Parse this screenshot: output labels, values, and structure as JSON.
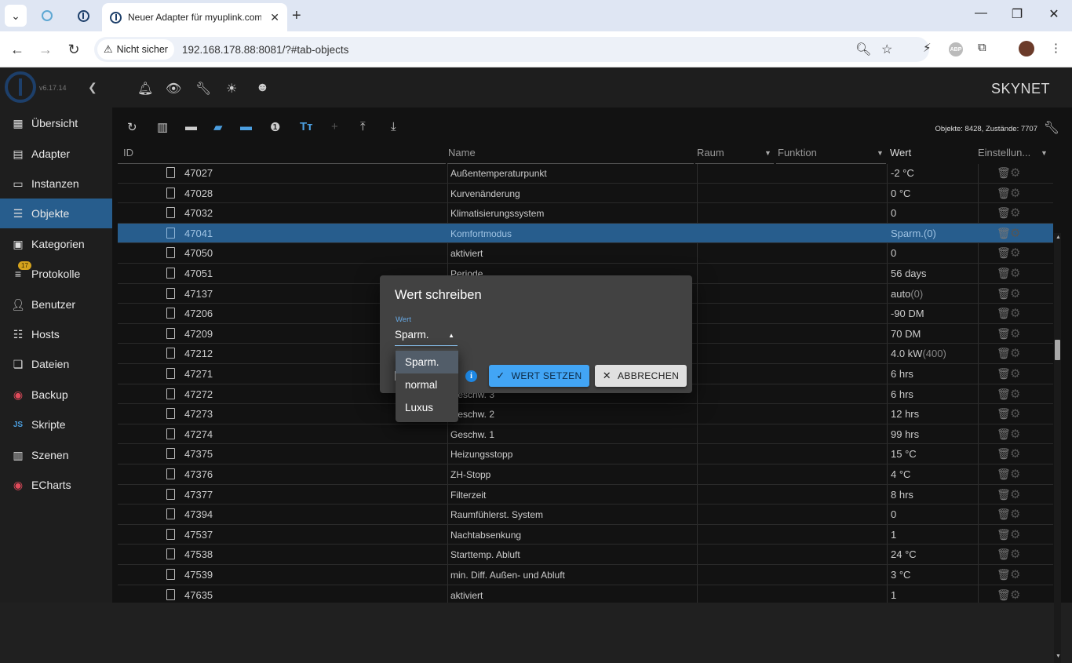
{
  "browser": {
    "tab_title": "Neuer Adapter für myuplink.com",
    "security_label": "Nicht sicher",
    "url": "192.168.178.88:8081/?#tab-objects"
  },
  "app": {
    "version": "v6.17.14",
    "host_name": "SKYNET",
    "object_count_text": "Objekte: 8428, Zustände: 7707",
    "accent_color": "#275d8d"
  },
  "sidebar": {
    "items": [
      {
        "label": "Übersicht",
        "icon": "grid-icon"
      },
      {
        "label": "Adapter",
        "icon": "store-icon"
      },
      {
        "label": "Instanzen",
        "icon": "instances-icon"
      },
      {
        "label": "Objekte",
        "icon": "list-icon"
      },
      {
        "label": "Kategorien",
        "icon": "categories-icon"
      },
      {
        "label": "Protokolle",
        "icon": "logs-icon"
      },
      {
        "label": "Benutzer",
        "icon": "user-icon"
      },
      {
        "label": "Hosts",
        "icon": "hosts-icon"
      },
      {
        "label": "Dateien",
        "icon": "files-icon"
      },
      {
        "label": "Backup",
        "icon": "backup-icon"
      },
      {
        "label": "Skripte",
        "icon": "js-icon"
      },
      {
        "label": "Szenen",
        "icon": "scenes-icon"
      },
      {
        "label": "ECharts",
        "icon": "echarts-icon"
      }
    ],
    "log_badge": "17"
  },
  "columns": {
    "id": "ID",
    "name": "Name",
    "room": "Raum",
    "function": "Funktion",
    "value": "Wert",
    "settings": "Einstellun..."
  },
  "rows": [
    {
      "id": "47027",
      "name": "Außentemperaturpunkt",
      "value": "-2 °C",
      "sub": ""
    },
    {
      "id": "47028",
      "name": "Kurvenänderung",
      "value": "0 °C",
      "sub": ""
    },
    {
      "id": "47032",
      "name": "Klimatisierungssystem",
      "value": "0",
      "sub": ""
    },
    {
      "id": "47041",
      "name": "Komfortmodus",
      "value": "Sparm.",
      "sub": "(0)"
    },
    {
      "id": "47050",
      "name": "aktiviert",
      "value": "0",
      "sub": ""
    },
    {
      "id": "47051",
      "name": "Periode",
      "value": "56 days",
      "sub": ""
    },
    {
      "id": "47137",
      "name": "",
      "value": "auto",
      "sub": "(0)"
    },
    {
      "id": "47206",
      "name": "",
      "value": "-90 DM",
      "sub": ""
    },
    {
      "id": "47209",
      "name": "",
      "value": "70 DM",
      "sub": ""
    },
    {
      "id": "47212",
      "name": "",
      "value": "4.0 kW",
      "sub": "(400)"
    },
    {
      "id": "47271",
      "name": "",
      "value": "6 hrs",
      "sub": ""
    },
    {
      "id": "47272",
      "name": "Geschw. 3",
      "value": "6 hrs",
      "sub": ""
    },
    {
      "id": "47273",
      "name": "Geschw. 2",
      "value": "12 hrs",
      "sub": ""
    },
    {
      "id": "47274",
      "name": "Geschw. 1",
      "value": "99 hrs",
      "sub": ""
    },
    {
      "id": "47375",
      "name": "Heizungsstopp",
      "value": "15 °C",
      "sub": ""
    },
    {
      "id": "47376",
      "name": "ZH-Stopp",
      "value": "4 °C",
      "sub": ""
    },
    {
      "id": "47377",
      "name": "Filterzeit",
      "value": "8 hrs",
      "sub": ""
    },
    {
      "id": "47394",
      "name": "Raumfühlerst. System",
      "value": "0",
      "sub": ""
    },
    {
      "id": "47537",
      "name": "Nachtabsenkung",
      "value": "1",
      "sub": ""
    },
    {
      "id": "47538",
      "name": "Starttemp. Abluft",
      "value": "24 °C",
      "sub": ""
    },
    {
      "id": "47539",
      "name": "min. Diff. Außen- und Abluft",
      "value": "3 °C",
      "sub": ""
    },
    {
      "id": "47635",
      "name": "aktiviert",
      "value": "1",
      "sub": ""
    }
  ],
  "selected_row_id": "47041",
  "dialog": {
    "title": "Wert schreiben",
    "field_label": "Wert",
    "selected_value": "Sparm.",
    "options": [
      "Sparm.",
      "normal",
      "Luxus"
    ],
    "set_button": "WERT SETZEN",
    "cancel_button": "ABBRECHEN",
    "info_glyph": "i"
  }
}
